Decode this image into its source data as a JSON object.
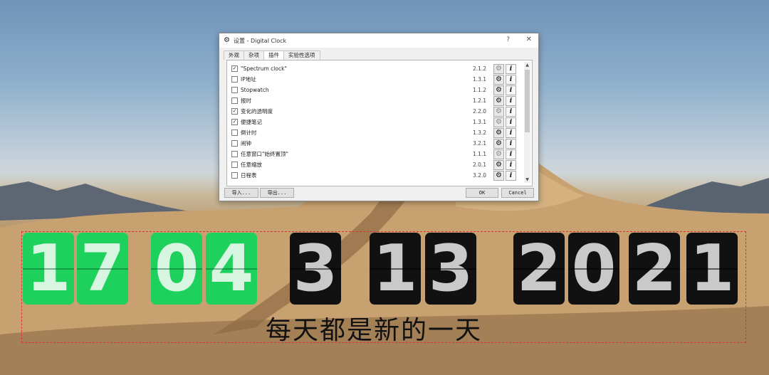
{
  "dialog": {
    "title": "设置 - Digital Clock",
    "help": "?",
    "close": "✕",
    "tabs": [
      "外观",
      "杂项",
      "插件",
      "实验性选项"
    ],
    "active_tab": "插件",
    "plugins": [
      {
        "name": "\"Spectrum clock\"",
        "version": "2.1.2",
        "checked": true,
        "mark": "✓"
      },
      {
        "name": "IP地址",
        "version": "1.3.1",
        "checked": false,
        "mark": ""
      },
      {
        "name": "Stopwatch",
        "version": "1.1.2",
        "checked": false,
        "mark": ""
      },
      {
        "name": "报时",
        "version": "1.2.1",
        "checked": false,
        "mark": ""
      },
      {
        "name": "变化的透明度",
        "version": "2.2.0",
        "checked": true,
        "mark": "✓"
      },
      {
        "name": "便捷笔记",
        "version": "1.3.1",
        "checked": true,
        "mark": "✓"
      },
      {
        "name": "倒计时",
        "version": "1.3.2",
        "checked": false,
        "mark": ""
      },
      {
        "name": "闹钟",
        "version": "3.2.1",
        "checked": false,
        "mark": ""
      },
      {
        "name": "任意窗口\"始终置顶\"",
        "version": "1.1.1",
        "checked": false,
        "mark": ""
      },
      {
        "name": "任意缩放",
        "version": "2.0.1",
        "checked": false,
        "mark": ""
      },
      {
        "name": "日程表",
        "version": "3.2.0",
        "checked": false,
        "mark": ""
      }
    ],
    "buttons": {
      "import": "导入...",
      "export": "导出...",
      "ok": "OK",
      "cancel": "Cancel"
    }
  },
  "clock": {
    "hour": [
      "1",
      "7"
    ],
    "minute": [
      "0",
      "4"
    ],
    "month": [
      "3"
    ],
    "day": [
      "1",
      "3"
    ],
    "year": [
      "2",
      "0",
      "2",
      "1"
    ],
    "slogan": "每天都是新的一天"
  },
  "colors": {
    "green_card": "#1ed15d",
    "dark_card": "#111111",
    "frame": "#dd3333"
  }
}
